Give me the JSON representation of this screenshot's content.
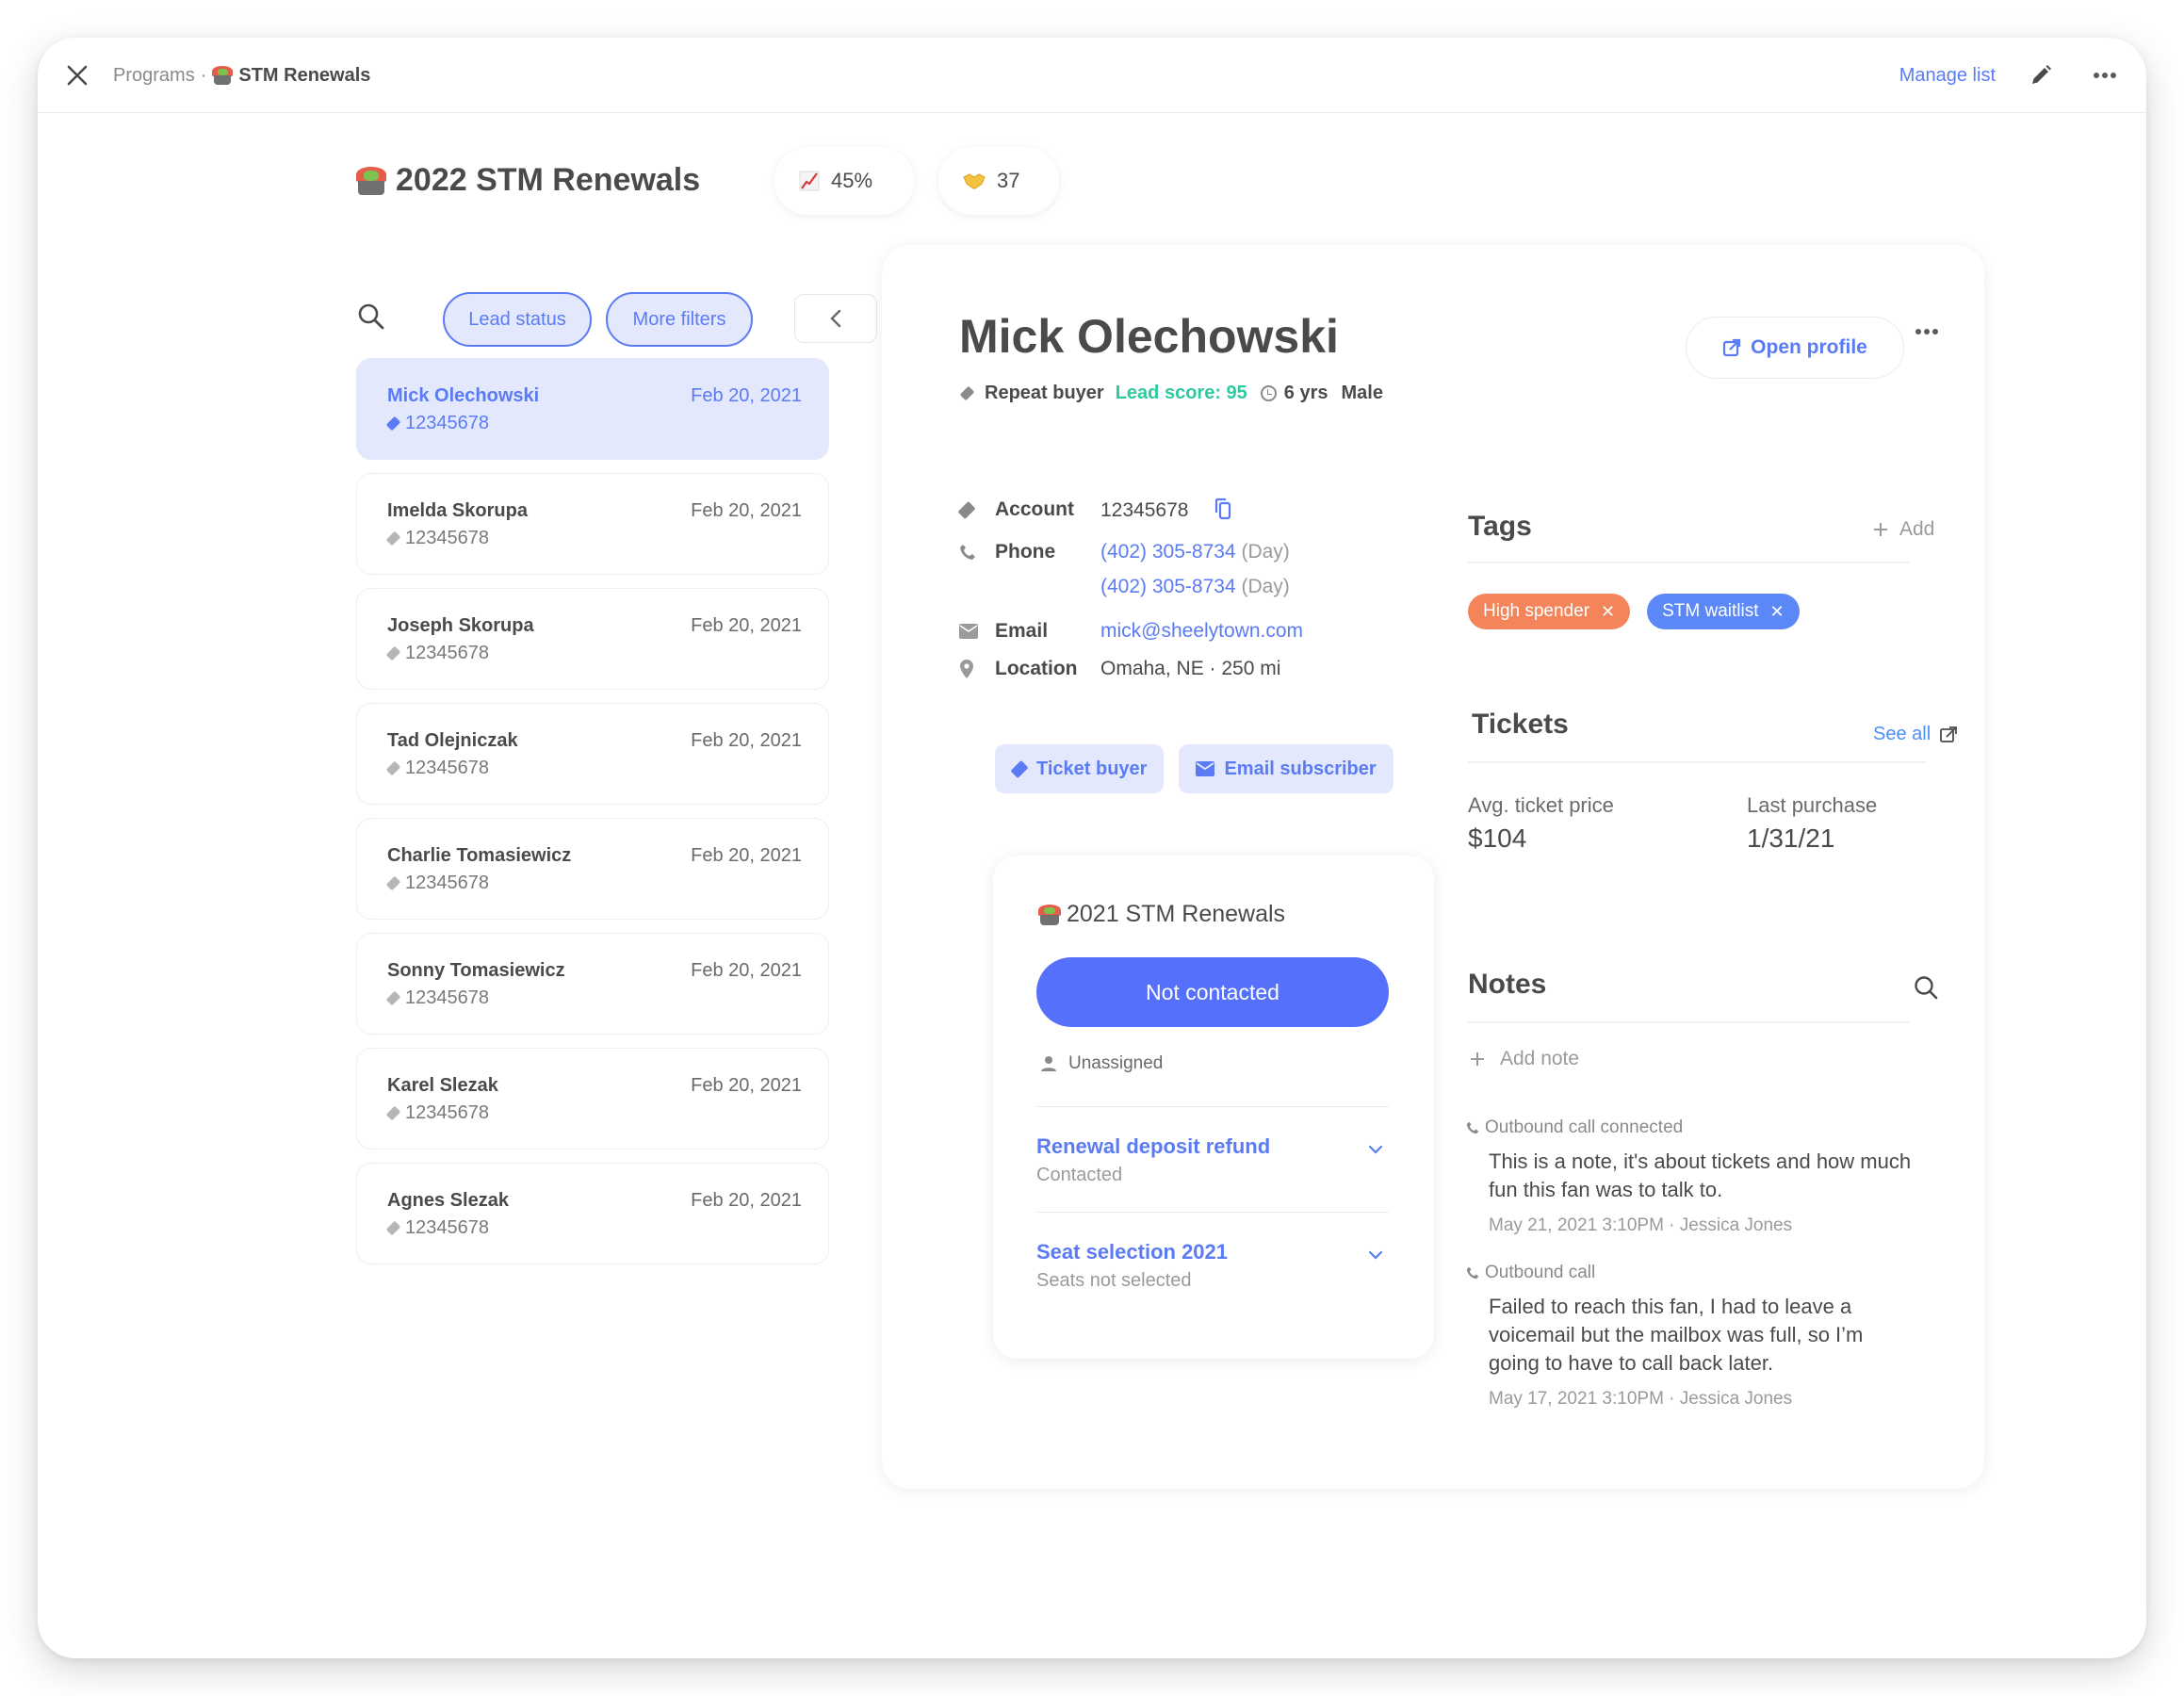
{
  "topbar": {
    "breadcrumb_parent": "Programs",
    "breadcrumb_separator": "·",
    "breadcrumb_current": "STM Renewals",
    "manage_list": "Manage list"
  },
  "program": {
    "title": "2022 STM Renewals",
    "stats": [
      {
        "icon": "chart-increasing-icon",
        "glyph": "📈",
        "value": "45%"
      },
      {
        "icon": "handshake-icon",
        "glyph": "🤝",
        "value": "37"
      }
    ]
  },
  "filters": {
    "lead_status": "Lead status",
    "more_filters": "More filters"
  },
  "leads": [
    {
      "name": "Mick Olechowski",
      "date": "Feb 20, 2021",
      "account": "12345678",
      "active": true
    },
    {
      "name": "Imelda Skorupa",
      "date": "Feb 20, 2021",
      "account": "12345678",
      "active": false
    },
    {
      "name": "Joseph Skorupa",
      "date": "Feb 20, 2021",
      "account": "12345678",
      "active": false
    },
    {
      "name": "Tad Olejniczak",
      "date": "Feb 20, 2021",
      "account": "12345678",
      "active": false
    },
    {
      "name": "Charlie Tomasiewicz",
      "date": "Feb 20, 2021",
      "account": "12345678",
      "active": false
    },
    {
      "name": "Sonny Tomasiewicz",
      "date": "Feb 20, 2021",
      "account": "12345678",
      "active": false
    },
    {
      "name": "Karel Slezak",
      "date": "Feb 20, 2021",
      "account": "12345678",
      "active": false
    },
    {
      "name": "Agnes Slezak",
      "date": "Feb 20, 2021",
      "account": "12345678",
      "active": false
    }
  ],
  "person": {
    "name": "Mick Olechowski",
    "buyer_type": "Repeat buyer",
    "lead_score": "Lead score: 95",
    "tenure": "6 yrs",
    "gender": "Male",
    "open_profile": "Open profile",
    "account_label": "Account",
    "account": "12345678",
    "phone_label": "Phone",
    "phones": [
      {
        "number": "(402) 305-8734",
        "type": "(Day)"
      },
      {
        "number": "(402) 305-8734",
        "type": "(Day)"
      }
    ],
    "email_label": "Email",
    "email": "mick@sheelytown.com",
    "location_label": "Location",
    "location": "Omaha, NE · 250 mi",
    "chips": [
      "Ticket buyer",
      "Email subscriber"
    ]
  },
  "program_card": {
    "title": "2021 STM Renewals",
    "status": "Not contacted",
    "assignee": "Unassigned",
    "tasks": [
      {
        "title": "Renewal deposit refund",
        "status": "Contacted"
      },
      {
        "title": "Seat selection 2021",
        "status": "Seats not selected"
      }
    ]
  },
  "tags": {
    "heading": "Tags",
    "add": "Add",
    "items": [
      {
        "label": "High spender",
        "color": "#f4845a"
      },
      {
        "label": "STM waitlist",
        "color": "#5b87f7"
      }
    ]
  },
  "tickets": {
    "heading": "Tickets",
    "see_all": "See all",
    "avg_label": "Avg. ticket price",
    "avg_value": "$104",
    "last_label": "Last purchase",
    "last_value": "1/31/21"
  },
  "notes": {
    "heading": "Notes",
    "add": "Add note",
    "items": [
      {
        "type": "Outbound call connected",
        "body": "This is a note, it's about tickets and how much fun this fan was to talk to.",
        "meta": "May 21, 2021 3:10PM · Jessica Jones"
      },
      {
        "type": "Outbound call",
        "body": "Failed to reach this fan, I had to leave a voicemail but the mailbox was full, so I’m going to have to call back later.",
        "meta": "May 17, 2021 3:10PM · Jessica Jones"
      }
    ]
  },
  "colors": {
    "accent": "#5b7bf5",
    "accent_light": "#e3e8fd",
    "status_button": "#5570fa",
    "lead_score": "#2ec99e"
  }
}
